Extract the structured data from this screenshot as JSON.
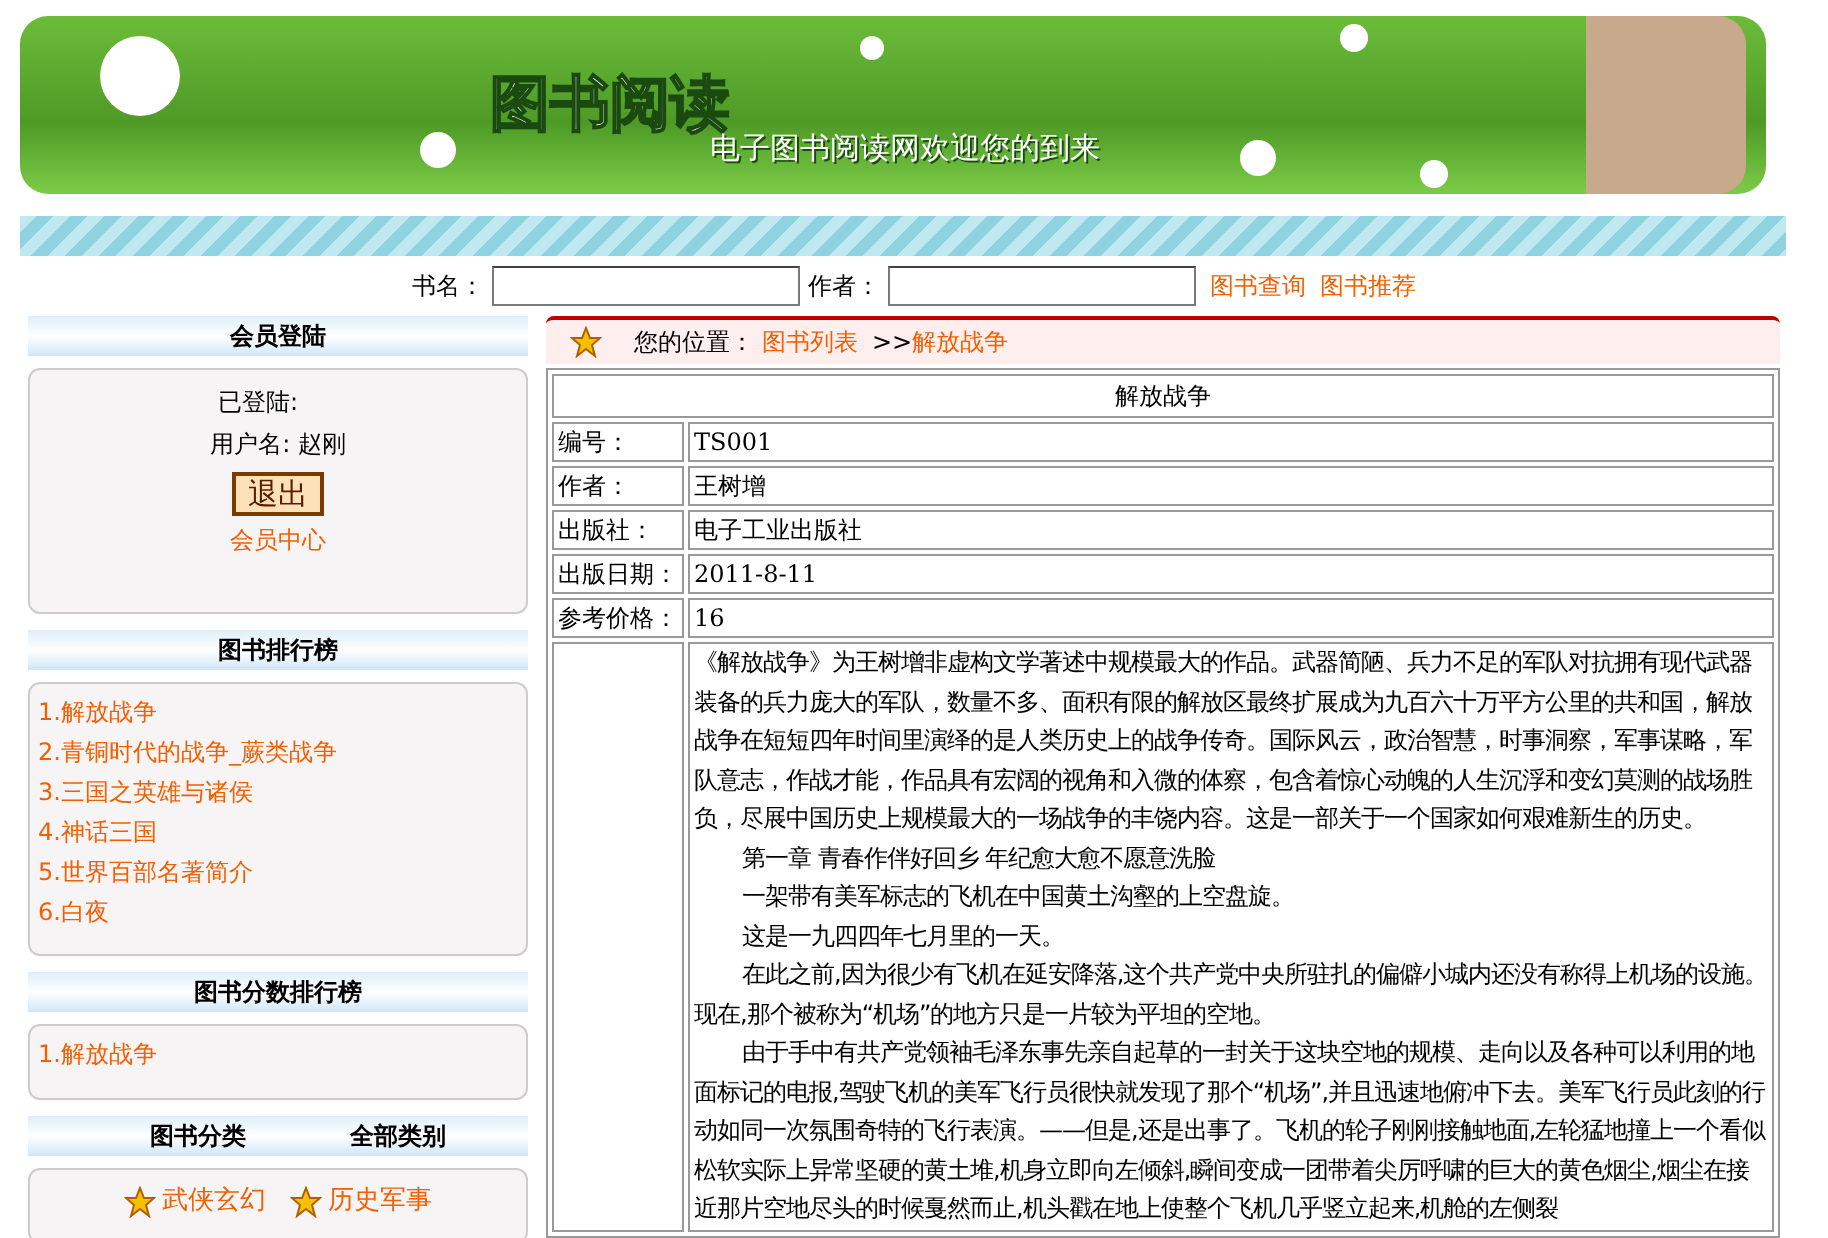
{
  "banner": {
    "title": "图书阅读",
    "subtitle": "电子图书阅读网欢迎您的到来"
  },
  "search": {
    "fields": [
      {
        "label": "书名："
      },
      {
        "label": "作者："
      }
    ],
    "links": [
      "图书查询",
      "图书推荐"
    ]
  },
  "login": {
    "heading": "会员登陆",
    "status": "已登陆:",
    "user": "用户名: 赵刚",
    "logout": "退出",
    "member_center": "会员中心"
  },
  "ranking": {
    "heading": "图书排行榜",
    "items": [
      "1.解放战争",
      "2.青铜时代的战争_蕨类战争",
      "3.三国之英雄与诸侯",
      "4.神话三国",
      "5.世界百部名著简介",
      "6.白夜"
    ]
  },
  "score_ranking": {
    "heading": "图书分数排行榜",
    "items": [
      "1.解放战争"
    ]
  },
  "categories": {
    "heading": "图书分类",
    "all": "全部类别",
    "items": [
      "武侠玄幻",
      "历史军事"
    ]
  },
  "breadcrumb": {
    "label": "您的位置：",
    "links": [
      "图书列表"
    ],
    "separator": ">>",
    "current": "解放战争"
  },
  "book": {
    "title": "解放战争",
    "fields": [
      {
        "label": "编号：",
        "value": "TS001"
      },
      {
        "label": "作者：",
        "value": "王树增"
      },
      {
        "label": "出版社：",
        "value": "电子工业出版社"
      },
      {
        "label": "出版日期：",
        "value": "2011-8-11"
      },
      {
        "label": "参考价格：",
        "value": "16"
      }
    ],
    "content": [
      {
        "kind": "plain",
        "text": "《解放战争》为王树增非虚构文学著述中规模最大的作品。武器简陋、兵力不足的军队对抗拥有现代武器装备的兵力庞大的军队，数量不多、面积有限的解放区最终扩展成为九百六十万平方公里的共和国，解放战争在短短四年时间里演绎的是人类历史上的战争传奇。国际风云，政治智慧，时事洞察，军事谋略，军队意志，作战才能，作品具有宏阔的视角和入微的体察，包含着惊心动魄的人生沉浮和变幻莫测的战场胜负，尽展中国历史上规模最大的一场战争的丰饶内容。这是一部关于一个国家如何艰难新生的历史。"
      },
      {
        "kind": "indent",
        "text": "第一章  青春作伴好回乡  年纪愈大愈不愿意洗脸"
      },
      {
        "kind": "indent",
        "text": "一架带有美军标志的飞机在中国黄土沟壑的上空盘旋。"
      },
      {
        "kind": "indent",
        "text": "这是一九四四年七月里的一天。"
      },
      {
        "kind": "indent",
        "text": "在此之前,因为很少有飞机在延安降落,这个共产党中央所驻扎的偏僻小城内还没有称得上机场的设施。现在,那个被称为“机场”的地方只是一片较为平坦的空地。"
      },
      {
        "kind": "indent",
        "text": "由于手中有共产党领袖毛泽东事先亲自起草的一封关于这块空地的规模、走向以及各种可以利用的地面标记的电报,驾驶飞机的美军飞行员很快就发现了那个“机场”,并且迅速地俯冲下去。美军飞行员此刻的行动如同一次氛围奇特的飞行表演。——但是,还是出事了。飞机的轮子刚刚接触地面,左轮猛地撞上一个看似松软实际上异常坚硬的黄土堆,机身立即向左倾斜,瞬间变成一团带着尖厉呼啸的巨大的黄色烟尘,烟尘在接近那片空地尽头的时候戛然而止,机头戳在地上使整个飞机几乎竖立起来,机舱的左侧裂"
      }
    ]
  }
}
